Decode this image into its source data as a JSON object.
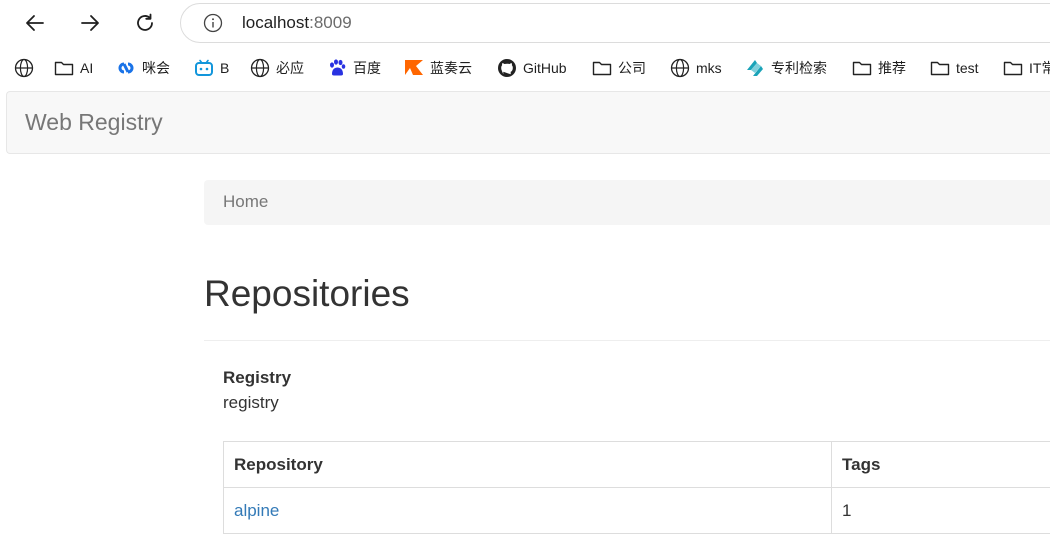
{
  "browser": {
    "url_host": "localhost",
    "url_port": ":8009",
    "bookmarks": [
      {
        "label": "",
        "icon": "globe-icon"
      },
      {
        "label": "AI",
        "icon": "folder-icon"
      },
      {
        "label": "咪会",
        "icon": "loop-logo-icon"
      },
      {
        "label": "B",
        "icon": "bilibili-icon"
      },
      {
        "label": "必应",
        "icon": "globe-icon"
      },
      {
        "label": "百度",
        "icon": "paw-icon"
      },
      {
        "label": "蓝奏云",
        "icon": "flag-icon"
      },
      {
        "label": "GitHub",
        "icon": "github-icon"
      },
      {
        "label": "公司",
        "icon": "folder-icon"
      },
      {
        "label": "mks",
        "icon": "globe-icon"
      },
      {
        "label": "专利检索",
        "icon": "patent-logo-icon"
      },
      {
        "label": "推荐",
        "icon": "folder-icon"
      },
      {
        "label": "test",
        "icon": "folder-icon"
      },
      {
        "label": "IT常",
        "icon": "folder-icon"
      }
    ]
  },
  "app": {
    "brand": "Web Registry",
    "breadcrumb": "Home",
    "title": "Repositories",
    "registry_label": "Registry",
    "registry_value": "registry"
  },
  "table": {
    "headers": [
      "Repository",
      "Tags"
    ],
    "rows": [
      {
        "repository": "alpine",
        "tags": "1"
      }
    ]
  },
  "colors": {
    "link": "#337ab7",
    "navbar_bg": "#f8f8f8",
    "breadcrumb_bg": "#f5f5f5",
    "text": "#333333",
    "muted": "#777777"
  }
}
